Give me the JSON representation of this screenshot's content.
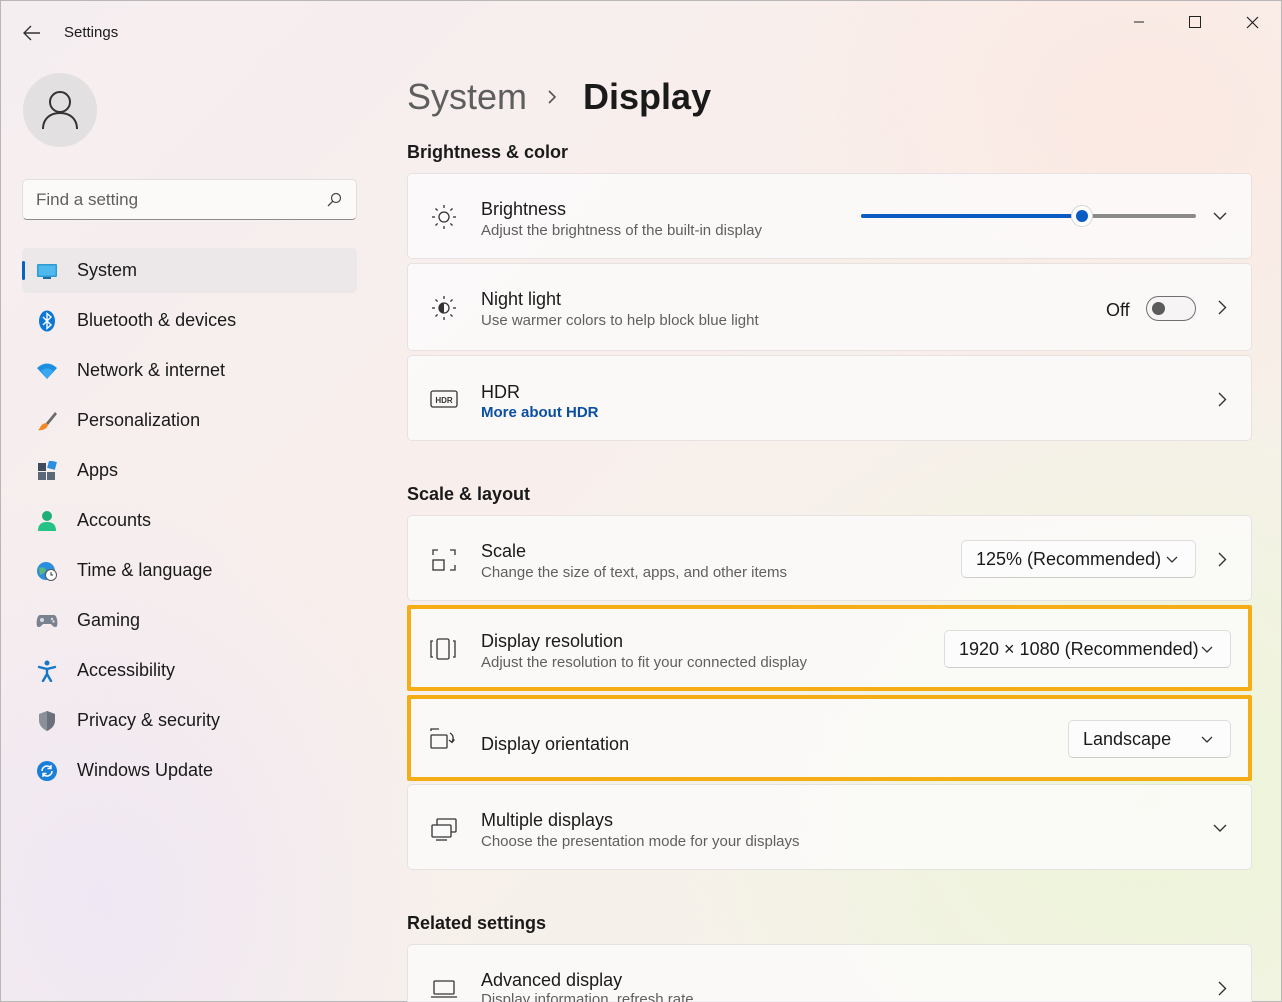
{
  "app": {
    "title": "Settings"
  },
  "search": {
    "placeholder": "Find a setting"
  },
  "sidebar": {
    "items": [
      {
        "label": "System",
        "icon": "system-icon",
        "active": true
      },
      {
        "label": "Bluetooth & devices",
        "icon": "bluetooth-icon"
      },
      {
        "label": "Network & internet",
        "icon": "wifi-icon"
      },
      {
        "label": "Personalization",
        "icon": "brush-icon"
      },
      {
        "label": "Apps",
        "icon": "apps-icon"
      },
      {
        "label": "Accounts",
        "icon": "accounts-icon"
      },
      {
        "label": "Time & language",
        "icon": "globe-clock-icon"
      },
      {
        "label": "Gaming",
        "icon": "gamepad-icon"
      },
      {
        "label": "Accessibility",
        "icon": "accessibility-icon"
      },
      {
        "label": "Privacy & security",
        "icon": "shield-icon"
      },
      {
        "label": "Windows Update",
        "icon": "update-icon"
      }
    ]
  },
  "breadcrumb": {
    "parent": "System",
    "current": "Display"
  },
  "sections": {
    "brightness_color": "Brightness & color",
    "scale_layout": "Scale & layout",
    "related": "Related settings"
  },
  "brightness": {
    "title": "Brightness",
    "subtitle": "Adjust the brightness of the built-in display",
    "level_percent": 66
  },
  "night_light": {
    "title": "Night light",
    "subtitle": "Use warmer colors to help block blue light",
    "state": "Off"
  },
  "hdr": {
    "title": "HDR",
    "link": "More about HDR"
  },
  "scale": {
    "title": "Scale",
    "subtitle": "Change the size of text, apps, and other items",
    "value": "125% (Recommended)"
  },
  "resolution": {
    "title": "Display resolution",
    "subtitle": "Adjust the resolution to fit your connected display",
    "value": "1920 × 1080 (Recommended)"
  },
  "orientation": {
    "title": "Display orientation",
    "value": "Landscape"
  },
  "multiple": {
    "title": "Multiple displays",
    "subtitle": "Choose the presentation mode for your displays"
  },
  "advanced": {
    "title": "Advanced display",
    "subtitle": "Display information, refresh rate"
  },
  "colors": {
    "accent": "#0a5bc4",
    "highlight": "#f4ad14"
  }
}
